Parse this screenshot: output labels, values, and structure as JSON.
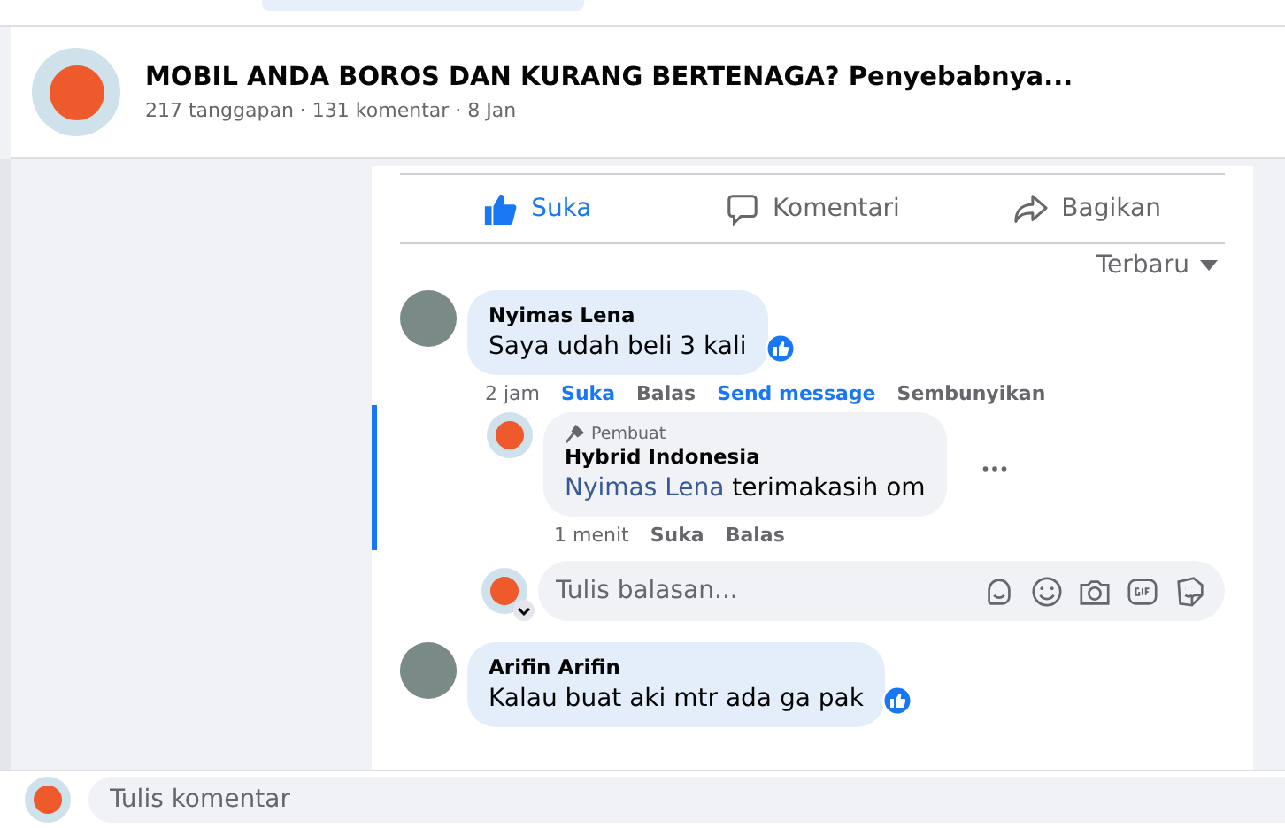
{
  "header": {
    "title": "MOBIL ANDA BOROS DAN KURANG BERTENAGA? Penyebabnya...",
    "meta": "217 tanggapan · 131 komentar · 8 Jan"
  },
  "actions": [
    {
      "kind": "like",
      "label": "Suka",
      "selected": true
    },
    {
      "kind": "comment",
      "label": "Komentari",
      "selected": false
    },
    {
      "kind": "share",
      "label": "Bagikan",
      "selected": false
    }
  ],
  "sort": {
    "label": "Terbaru"
  },
  "comments": [
    {
      "author": "Nyimas Lena",
      "kind": "person",
      "text": "Saya udah beli 3 kali",
      "liked": true,
      "time": "2 jam",
      "links": [
        {
          "label": "Suka",
          "active": true
        },
        {
          "label": "Balas",
          "active": false
        },
        {
          "label": "Send message",
          "active": true
        },
        {
          "label": "Sembunyikan",
          "active": false
        }
      ],
      "replies": [
        {
          "badge": "Pembuat",
          "author": "Hybrid Indonesia",
          "kind": "page",
          "mention": "Nyimas Lena",
          "text": "terimakasih om",
          "liked": false,
          "focused": true,
          "time": "1 menit",
          "links": [
            {
              "label": "Suka",
              "active": false
            },
            {
              "label": "Balas",
              "active": false
            }
          ]
        }
      ],
      "reply_box": {
        "placeholder": "Tulis balasan..."
      }
    },
    {
      "author": "Arifin Arifin",
      "kind": "person",
      "text": "Kalau buat aki mtr ada ga pak",
      "liked": true
    }
  ],
  "composer": {
    "placeholder": "Tulis komentar"
  }
}
